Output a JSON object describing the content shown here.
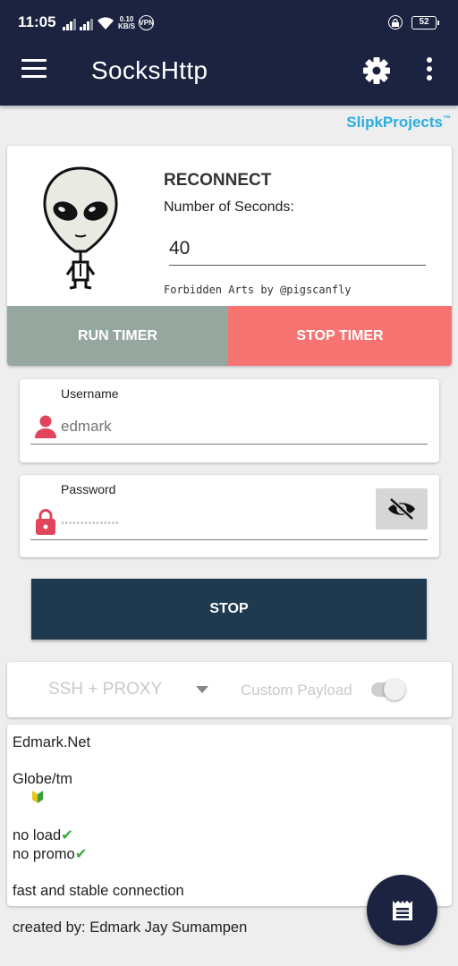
{
  "status_bar": {
    "time": "11:05",
    "net_speed_value": "0.10",
    "net_speed_unit": "KB/S",
    "vpn": "VPN",
    "battery": "52"
  },
  "app_bar": {
    "title": "SocksHttp",
    "icons": [
      "menu-icon",
      "gear-icon",
      "more-vert-icon"
    ]
  },
  "brand": {
    "text": "SlipkProjects",
    "tm": "™",
    "color": "#2aaee0"
  },
  "reconnect": {
    "title": "RECONNECT",
    "seconds_label": "Number of Seconds:",
    "seconds_value": "40",
    "credit": "Forbidden Arts by @pigscanfly",
    "run_timer_label": "RUN TIMER",
    "stop_timer_label": "STOP TIMER",
    "run_timer_color": "#95a79e",
    "stop_timer_color": "#f77472"
  },
  "username": {
    "label": "Username",
    "placeholder": "edmark",
    "icon": "person-icon"
  },
  "password": {
    "label": "Password",
    "masked_value": "•••••••••••••••",
    "icon": "lock-icon",
    "toggle_icon": "eye-off-icon"
  },
  "connect_button": {
    "label": "STOP",
    "color": "#1f3a4f"
  },
  "mode": {
    "selected": "SSH + PROXY",
    "custom_payload_label": "Custom Payload",
    "custom_payload_enabled": false
  },
  "notes": {
    "line1": "Edmark.Net",
    "line2": "Globe/tm",
    "line3": "no load",
    "line4": "no promo",
    "line5": "fast and stable connection",
    "line6": "created by: Edmark Jay Sumampen",
    "check_mark": "✔"
  },
  "fab": {
    "icon": "receipt-log-icon"
  },
  "colors": {
    "app_bar": "#1b2340",
    "accent_red": "#e2445c"
  }
}
